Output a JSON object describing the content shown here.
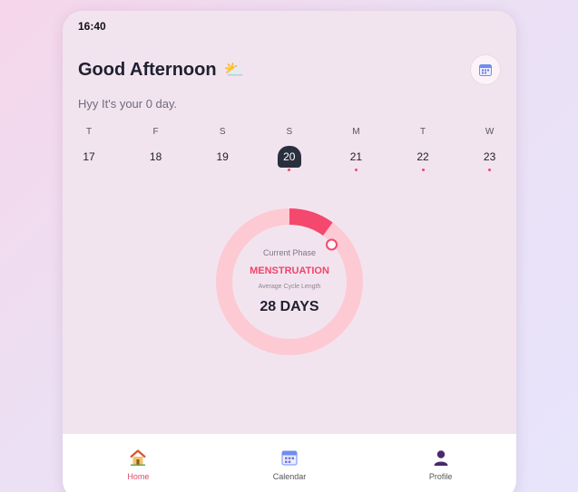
{
  "status_bar": {
    "time": "16:40"
  },
  "header": {
    "greeting": "Good Afternoon",
    "weather_icon": "sun-behind-cloud-icon",
    "calendar_icon": "calendar-icon"
  },
  "subtitle": "Hyy It's your 0 day.",
  "week": [
    {
      "letter": "T",
      "num": "17",
      "selected": false,
      "dot": false
    },
    {
      "letter": "F",
      "num": "18",
      "selected": false,
      "dot": false
    },
    {
      "letter": "S",
      "num": "19",
      "selected": false,
      "dot": false
    },
    {
      "letter": "S",
      "num": "20",
      "selected": true,
      "dot": true
    },
    {
      "letter": "M",
      "num": "21",
      "selected": false,
      "dot": true
    },
    {
      "letter": "T",
      "num": "22",
      "selected": false,
      "dot": true
    },
    {
      "letter": "W",
      "num": "23",
      "selected": false,
      "dot": true
    }
  ],
  "cycle": {
    "phase_label": "Current Phase",
    "phase_name": "MENSTRUATION",
    "avg_label": "Average Cycle Length",
    "days_value": "28 DAYS",
    "progress_fraction": 0.1,
    "colors": {
      "track": "#fdc9d3",
      "progress": "#f5486e"
    }
  },
  "nav": [
    {
      "label": "Home",
      "icon": "home-icon",
      "active": true
    },
    {
      "label": "Calendar",
      "icon": "calendar-icon",
      "active": false
    },
    {
      "label": "Profile",
      "icon": "user-icon",
      "active": false
    }
  ]
}
